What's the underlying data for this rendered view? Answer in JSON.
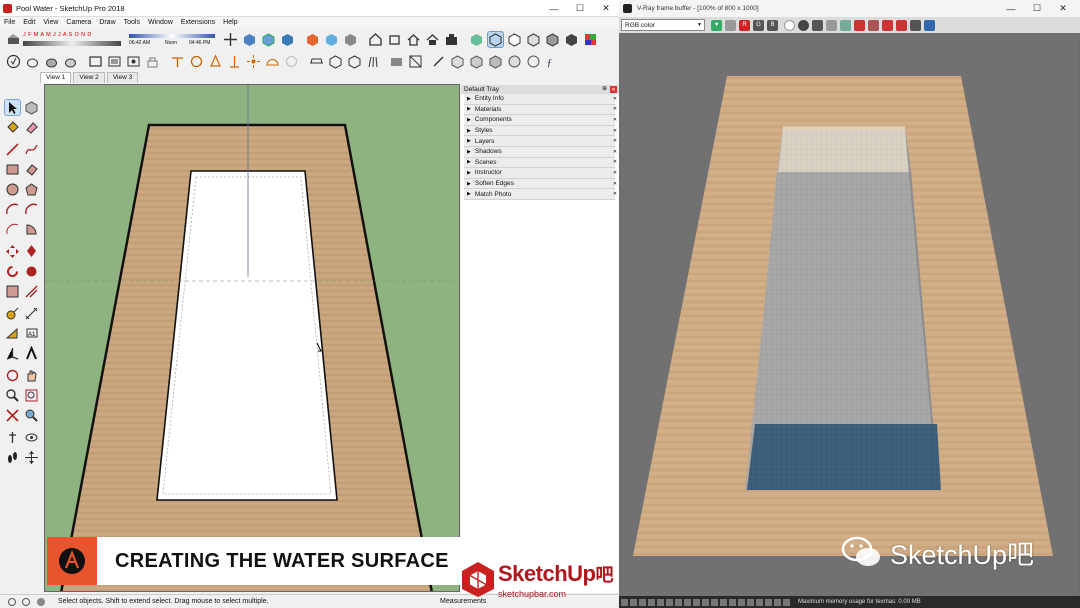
{
  "sketchup": {
    "title": "Pool Water - SketchUp Pro 2018",
    "window_buttons": [
      "—",
      "☐",
      "✕"
    ],
    "menu": [
      "File",
      "Edit",
      "View",
      "Camera",
      "Draw",
      "Tools",
      "Window",
      "Extensions",
      "Help"
    ],
    "shadow_months": "J F M A M J J A S O N D",
    "shadow_time_start": "06:42 AM",
    "shadow_noon": "Noon",
    "shadow_time_end": "04:46 PM",
    "view_tabs": [
      "View 1",
      "View 2",
      "View 3"
    ],
    "active_view_tab": "View 1",
    "tray": {
      "title": "Default Tray",
      "panels": [
        "Entity Info",
        "Materials",
        "Components",
        "Styles",
        "Layers",
        "Shadows",
        "Scenes",
        "Instructor",
        "Soften Edges",
        "Match Photo"
      ]
    },
    "status_message": "Select objects. Shift to extend select. Drag mouse to select multiple.",
    "measurements_label": "Measurements"
  },
  "vray": {
    "title": "V-Ray frame buffer - [100% of 800 x 1000]",
    "channel_select": "RGB color",
    "channel_buttons": [
      "R",
      "G",
      "B"
    ],
    "status_message": "Maximum memory usage for texmas: 0.00 MB"
  },
  "overlay": {
    "banner_text": "CREATING THE WATER SURFACE",
    "logo_name": "SketchUp",
    "logo_suffix": "吧",
    "logo_site": "sketchupbar.com",
    "wechat_text": "SketchUp吧"
  },
  "colors": {
    "grass": "#8fb380",
    "wood_deck": "#c9a57e",
    "pool_water": "#3f5f7b",
    "banner_accent": "#e8542d",
    "logo_red": "#b1161c"
  }
}
